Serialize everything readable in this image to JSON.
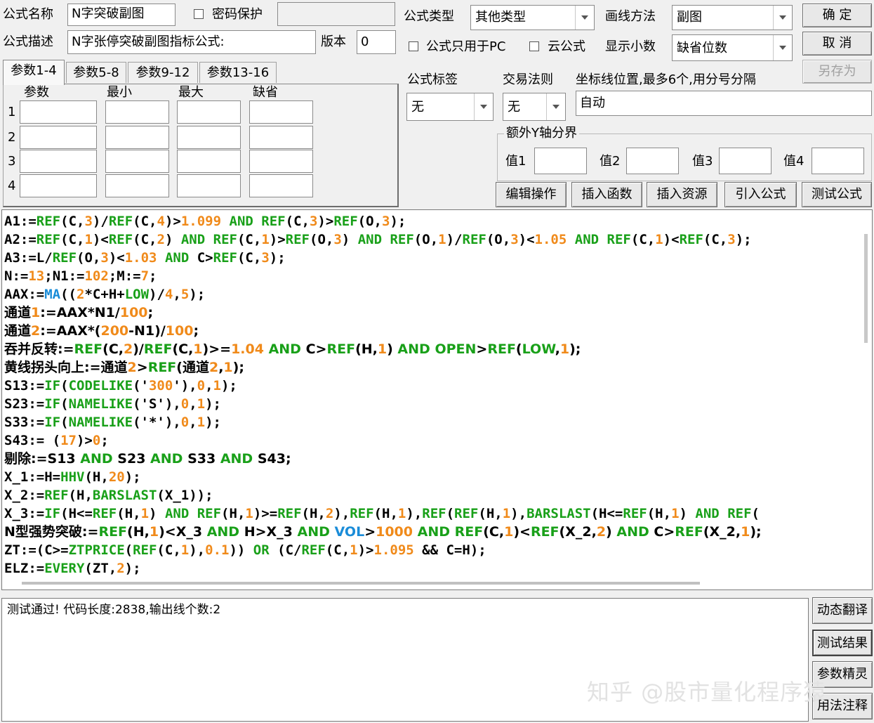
{
  "form": {
    "name_label": "公式名称",
    "name_value": "N字突破副图",
    "password_label": "密码保护",
    "desc_label": "公式描述",
    "desc_value": "N字张停突破副图指标公式:",
    "version_label": "版本",
    "version_value": "0",
    "type_label": "公式类型",
    "type_value": "其他类型",
    "draw_label": "画线方法",
    "draw_value": "副图",
    "pc_only_label": "公式只用于PC",
    "cloud_label": "云公式",
    "decimals_label": "显示小数",
    "decimals_value": "缺省位数",
    "tag_label": "公式标签",
    "tag_value": "无",
    "rule_label": "交易法则",
    "rule_value": "无",
    "coord_label": "坐标线位置,最多6个,用分号分隔",
    "coord_value": "自动",
    "yaxis_group_label": "额外Y轴分界",
    "y_labels": [
      "值1",
      "值2",
      "值3",
      "值4"
    ]
  },
  "buttons": {
    "ok": "确 定",
    "cancel": "取 消",
    "save_as": "另存为",
    "edit_ops": "编辑操作",
    "insert_func": "插入函数",
    "insert_res": "插入资源",
    "import_formula": "引入公式",
    "test_formula": "测试公式",
    "dynamic_translate": "动态翻译",
    "test_result": "测试结果",
    "param_wizard": "参数精灵",
    "usage_notes": "用法注释"
  },
  "tabs": [
    "参数1-4",
    "参数5-8",
    "参数9-12",
    "参数13-16"
  ],
  "params": {
    "headers": [
      "参数",
      "最小",
      "最大",
      "缺省"
    ],
    "rows": [
      "1",
      "2",
      "3",
      "4"
    ]
  },
  "code_lines": [
    "A1:=REF(C,3)/REF(C,4)>1.099 AND REF(C,3)>REF(O,3);",
    "A2:=REF(C,1)<REF(C,2) AND REF(C,1)>REF(O,3) AND REF(O,1)/REF(O,3)<1.05 AND REF(C,1)<REF(C,3);",
    "A3:=L/REF(O,3)<1.03 AND C>REF(C,3);",
    "N:=13;N1:=102;M:=7;",
    "AAX:=MA((2*C+H+LOW)/4,5);",
    "通道1:=AAX*N1/100;",
    "通道2:=AAX*(200-N1)/100;",
    "吞并反转:=REF(C,2)/REF(C,1)>=1.04 AND C>REF(H,1) AND OPEN>REF(LOW,1);",
    "黄线拐头向上:=通道2>REF(通道2,1);",
    "S13:=IF(CODELIKE('300'),0,1);",
    "S23:=IF(NAMELIKE('S'),0,1);",
    "S33:=IF(NAMELIKE('*'),0,1);",
    "S43:= (17)>0;",
    "剔除:=S13 AND S23 AND S33 AND S43;",
    "X_1:=H=HHV(H,20);",
    "X_2:=REF(H,BARSLAST(X_1));",
    "X_3:=IF(H<=REF(H,1) AND REF(H,1)>=REF(H,2),REF(H,1),REF(REF(H,1),BARSLAST(H<=REF(H,1) AND REF(",
    "N型强势突破:=REF(H,1)<X_3 AND H>X_3 AND VOL>1000 AND REF(C,1)<REF(X_2,2) AND C>REF(X_2,1);",
    "ZT:=(C>=ZTPRICE(REF(C,1),0.1)) OR (C/REF(C,1)>1.095 && C=H);",
    "ELZ:=EVERY(ZT,2);"
  ],
  "output_text": "测试通过! 代码长度:2838,输出线个数:2",
  "watermark": "知乎 @股市量化程序猿"
}
